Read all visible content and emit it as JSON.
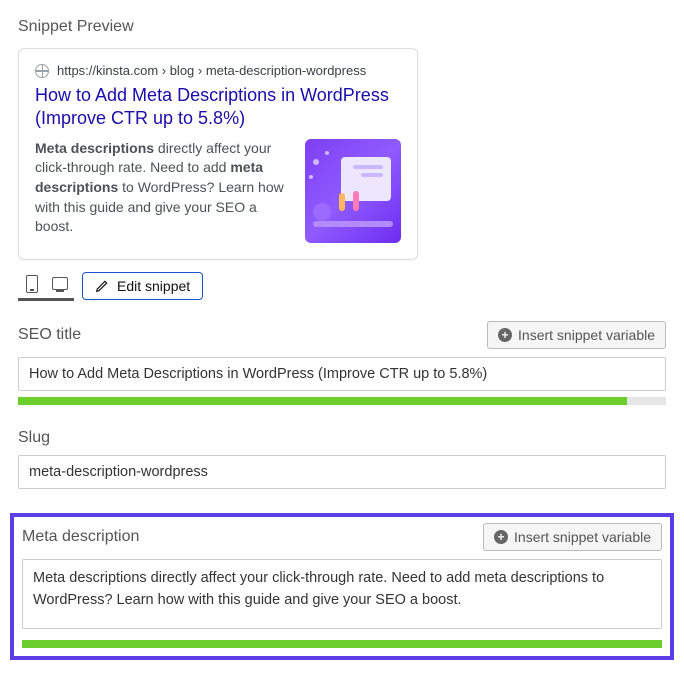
{
  "heading": "Snippet Preview",
  "preview": {
    "url": "https://kinsta.com › blog › meta-description-wordpress",
    "title": "How to Add Meta Descriptions in WordPress (Improve CTR up to 5.8%)",
    "desc_bold1": "Meta descriptions",
    "desc_mid1": " directly affect your click-through rate. Need to add ",
    "desc_bold2": "meta descriptions",
    "desc_mid2": " to WordPress? Learn how with this guide and give your SEO a boost."
  },
  "toolbar": {
    "edit_snippet": "Edit snippet"
  },
  "seo_title": {
    "label": "SEO title",
    "insert": "Insert snippet variable",
    "value": "How to Add Meta Descriptions in WordPress (Improve CTR up to 5.8%)",
    "progress_pct": 94
  },
  "slug": {
    "label": "Slug",
    "value": "meta-description-wordpress"
  },
  "meta_desc": {
    "label": "Meta description",
    "insert": "Insert snippet variable",
    "value": "Meta descriptions directly affect your click-through rate. Need to add meta descriptions to WordPress? Learn how with this guide and give your SEO a boost.",
    "progress_pct": 100
  }
}
